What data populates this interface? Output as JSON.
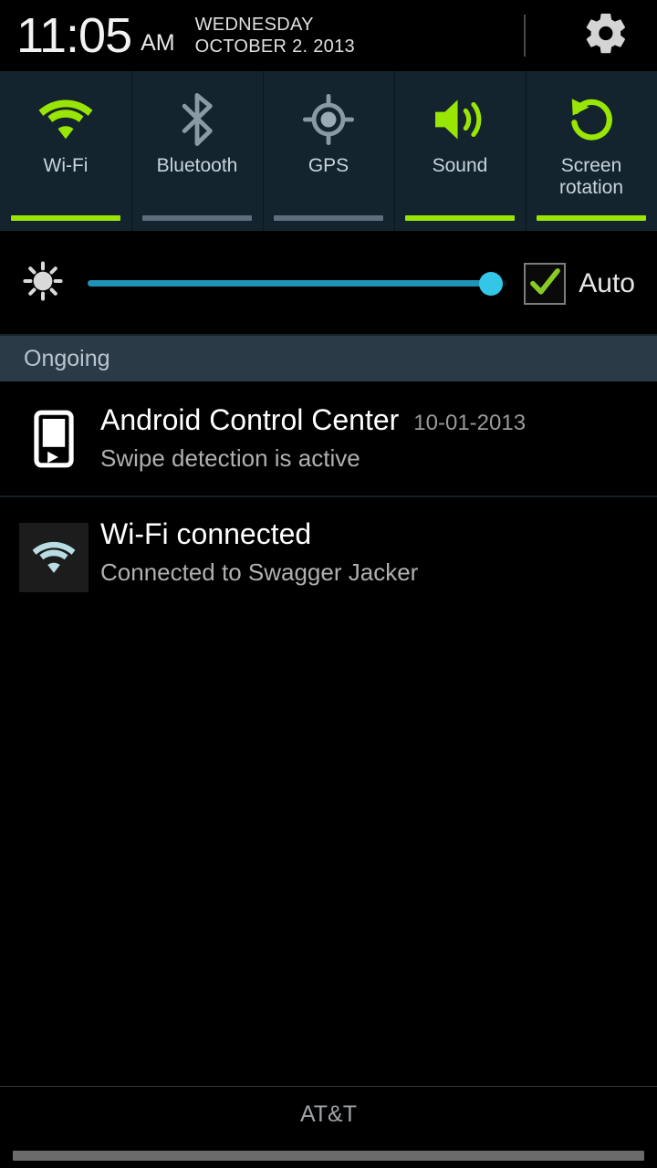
{
  "statusbar": {
    "time": "11:05",
    "ampm": "AM",
    "day": "WEDNESDAY",
    "date": "OCTOBER 2. 2013",
    "settings_icon": "gear-icon"
  },
  "quick_toggles": [
    {
      "label": "Wi-Fi",
      "icon": "wifi-icon",
      "state": "on"
    },
    {
      "label": "Bluetooth",
      "icon": "bluetooth-icon",
      "state": "off"
    },
    {
      "label": "GPS",
      "icon": "gps-crosshair-icon",
      "state": "off"
    },
    {
      "label": "Sound",
      "icon": "speaker-volume-icon",
      "state": "on"
    },
    {
      "label": "Screen\nrotation",
      "icon": "screen-rotation-icon",
      "state": "on"
    }
  ],
  "brightness": {
    "icon": "brightness-sun-icon",
    "value_percent": 96,
    "auto_label": "Auto",
    "auto_checked": true,
    "track_color": "#2092b8",
    "thumb_color": "#34c6e6"
  },
  "sections": {
    "ongoing_label": "Ongoing"
  },
  "notifications": [
    {
      "icon": "phone-swipe-icon",
      "title": "Android Control Center",
      "time": "10-01-2013",
      "subtitle": "Swipe detection is active"
    },
    {
      "icon": "wifi-connected-icon",
      "title": "Wi-Fi connected",
      "time": "",
      "subtitle": "Connected to Swagger Jacker"
    }
  ],
  "bottom": {
    "carrier": "AT&T"
  },
  "colors": {
    "accent_green": "#99e605",
    "toggle_bg": "#14242e",
    "section_bg": "#2b3a47",
    "off_gray": "#8a9aa5"
  }
}
